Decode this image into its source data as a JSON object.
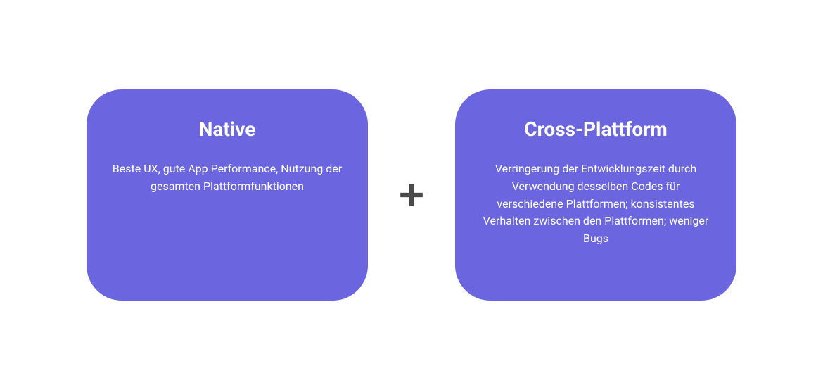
{
  "cards": [
    {
      "title": "Native",
      "body": "Beste UX, gute App Performance, Nutzung der gesamten Plattformfunktionen"
    },
    {
      "title": "Cross-Plattform",
      "body": "Verringerung der Entwicklungszeit durch Verwendung desselben Codes für verschiedene Plattformen; konsistentes Verhalten zwischen den Plattformen; weniger Bugs"
    }
  ],
  "colors": {
    "card_bg": "#6b65e0",
    "plus": "#4a4a4a"
  }
}
